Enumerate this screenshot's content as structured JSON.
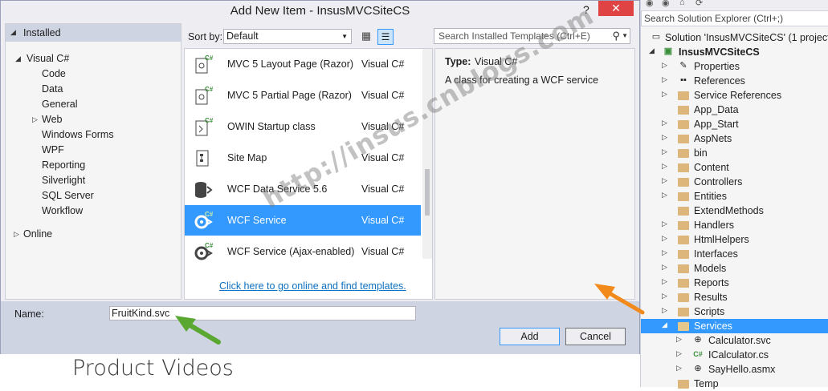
{
  "background": {
    "heading": "Product Videos"
  },
  "dialog": {
    "title": "Add New Item - InsusMVCSiteCS",
    "help_glyph": "?",
    "close_glyph": "✕"
  },
  "tree": {
    "installed": "Installed",
    "visual_csharp": "Visual C#",
    "children": [
      "Code",
      "Data",
      "General",
      "Web",
      "Windows Forms",
      "WPF",
      "Reporting",
      "Silverlight",
      "SQL Server",
      "Workflow"
    ],
    "online": "Online"
  },
  "toolbar": {
    "sort_label": "Sort by:",
    "sort_value": "Default",
    "search_placeholder": "Search Installed Templates (Ctrl+E)"
  },
  "templates": [
    {
      "name": "MVC 5 Layout Page (Razor)",
      "lang": "Visual C#",
      "icon": "razor-page-icon"
    },
    {
      "name": "MVC 5 Partial Page (Razor)",
      "lang": "Visual C#",
      "icon": "razor-page-icon"
    },
    {
      "name": "OWIN Startup class",
      "lang": "Visual C#",
      "icon": "owin-class-icon"
    },
    {
      "name": "Site Map",
      "lang": "Visual C#",
      "icon": "sitemap-icon"
    },
    {
      "name": "WCF Data Service 5.6",
      "lang": "Visual C#",
      "icon": "data-service-icon"
    },
    {
      "name": "WCF Service",
      "lang": "Visual C#",
      "icon": "wcf-service-icon",
      "selected": true
    },
    {
      "name": "WCF Service (Ajax-enabled)",
      "lang": "Visual C#",
      "icon": "wcf-service-icon"
    }
  ],
  "online_link": "Click here to go online and find templates.",
  "details": {
    "type_label": "Type:",
    "type_value": "Visual C#",
    "description": "A class for creating a WCF service"
  },
  "bottom": {
    "name_label": "Name:",
    "name_value": "FruitKind.svc",
    "add_label": "Add",
    "cancel_label": "Cancel"
  },
  "solution_explorer": {
    "search_placeholder": "Search Solution Explorer (Ctrl+;)",
    "items": [
      {
        "label": "Solution 'InsusMVCSiteCS' (1 project)",
        "icon": "solution-icon"
      },
      {
        "label": "InsusMVCSiteCS",
        "icon": "project-icon"
      },
      {
        "label": "Properties",
        "icon": "wrench-icon"
      },
      {
        "label": "References",
        "icon": "references-icon"
      },
      {
        "label": "Service References",
        "icon": "folder-icon"
      },
      {
        "label": "App_Data",
        "icon": "folder-icon"
      },
      {
        "label": "App_Start",
        "icon": "folder-icon"
      },
      {
        "label": "AspNets",
        "icon": "folder-icon"
      },
      {
        "label": "bin",
        "icon": "folder-icon"
      },
      {
        "label": "Content",
        "icon": "folder-icon"
      },
      {
        "label": "Controllers",
        "icon": "folder-icon"
      },
      {
        "label": "Entities",
        "icon": "folder-icon"
      },
      {
        "label": "ExtendMethods",
        "icon": "folder-icon"
      },
      {
        "label": "Handlers",
        "icon": "folder-icon"
      },
      {
        "label": "HtmlHelpers",
        "icon": "folder-icon"
      },
      {
        "label": "Interfaces",
        "icon": "folder-icon"
      },
      {
        "label": "Models",
        "icon": "folder-icon"
      },
      {
        "label": "Reports",
        "icon": "folder-icon"
      },
      {
        "label": "Results",
        "icon": "folder-icon"
      },
      {
        "label": "Scripts",
        "icon": "folder-icon"
      },
      {
        "label": "Services",
        "icon": "folder-open-icon",
        "selected": true
      },
      {
        "label": "Calculator.svc",
        "icon": "svc-file-icon"
      },
      {
        "label": "ICalculator.cs",
        "icon": "csharp-file-icon"
      },
      {
        "label": "SayHello.asmx",
        "icon": "asmx-file-icon"
      },
      {
        "label": "Temp",
        "icon": "folder-icon"
      }
    ]
  },
  "watermark": "http://insus.cnblogs.com",
  "colors": {
    "selection": "#3399ff",
    "link": "#0e70c0",
    "close": "#e04343",
    "arrow_green": "#5aa832",
    "arrow_orange": "#f28a1b"
  }
}
